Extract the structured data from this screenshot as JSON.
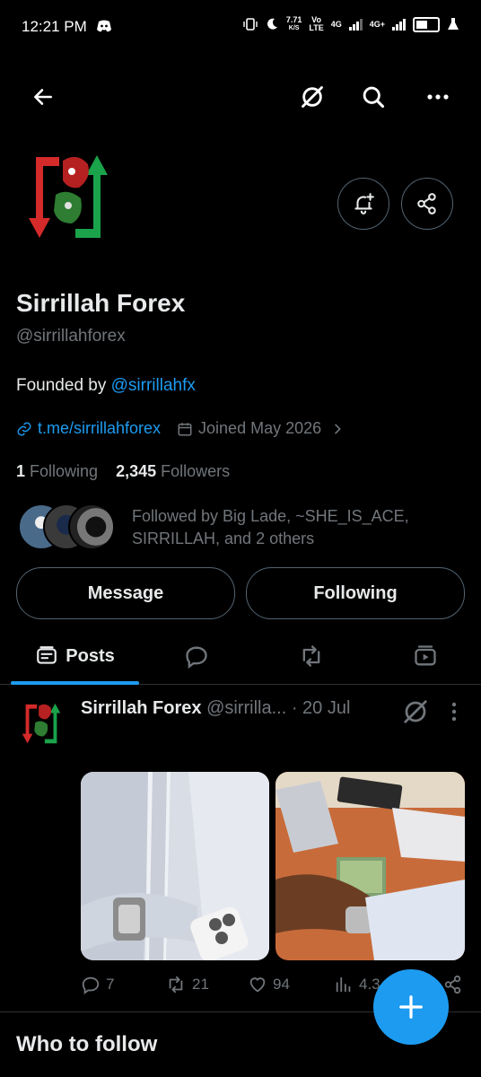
{
  "status_bar": {
    "time": "12:21 PM",
    "speed_value": "7.71",
    "speed_unit": "K/S",
    "volte_top": "Vo",
    "volte_bottom": "LTE",
    "net1": "4G",
    "net2": "4G+",
    "icons": [
      "discord-icon",
      "vibrate-icon",
      "moon-icon",
      "signal-icon",
      "battery-icon",
      "flask-icon"
    ]
  },
  "nav": {
    "icons": [
      "back-arrow-icon",
      "grok-icon",
      "search-icon",
      "more-icon"
    ]
  },
  "profile": {
    "name": "Sirrillah Forex",
    "handle": "@sirrillahforex",
    "bio_prefix": "Founded by ",
    "bio_mention": "@sirrillahfx",
    "website": "t.me/sirrillahforex",
    "joined": "Joined May 2026",
    "following_count": "1",
    "following_label": "Following",
    "followers_count": "2,345",
    "followers_label": "Followers",
    "followed_by": "Followed by Big Lade, ~SHE_IS_ACE, SIRRILLAH, and 2 others",
    "message_label": "Message",
    "following_button_label": "Following"
  },
  "tabs": [
    {
      "label": "Posts",
      "icon": "posts-icon",
      "active": true
    },
    {
      "label": "",
      "icon": "reply-icon"
    },
    {
      "label": "",
      "icon": "repost-icon"
    },
    {
      "label": "",
      "icon": "media-icon"
    }
  ],
  "post": {
    "author": "Sirrillah Forex",
    "handle": "@sirrilla...",
    "date": "· 20 Jul",
    "replies": "7",
    "reposts": "21",
    "likes": "94",
    "views": "4.3"
  },
  "who_to_follow": "Who to follow",
  "colors": {
    "accent": "#1d9bf0",
    "background": "#000000",
    "muted": "#71767b",
    "text": "#e7e9ea"
  }
}
